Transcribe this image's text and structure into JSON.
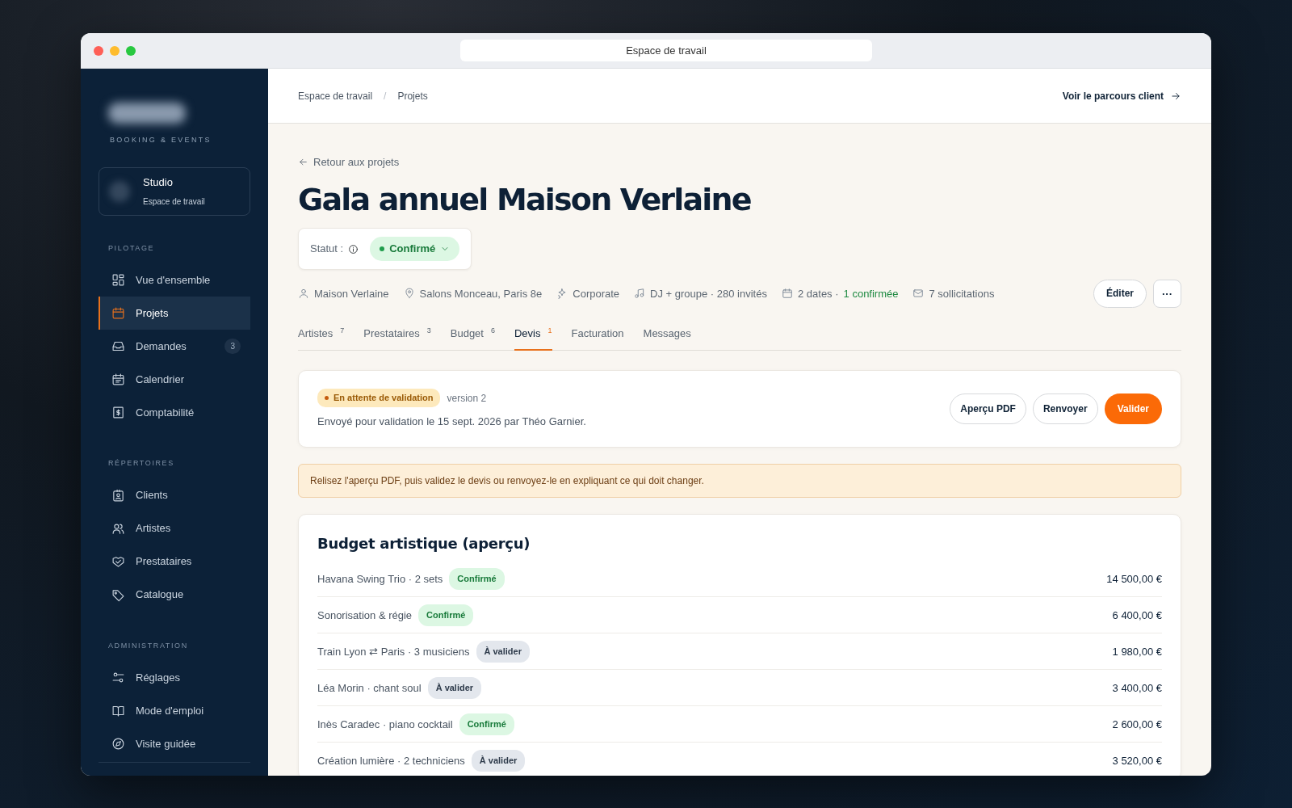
{
  "window": {
    "title": "Espace de travail"
  },
  "sidebar": {
    "tagline": "BOOKING & EVENTS",
    "workspace": {
      "name": "Studio",
      "subtitle": "Espace de travail"
    },
    "sections": [
      {
        "heading": "PILOTAGE",
        "items": [
          {
            "label": "Vue d'ensemble",
            "selected": false
          },
          {
            "label": "Projets",
            "selected": true
          },
          {
            "label": "Demandes",
            "selected": false,
            "count": "3"
          },
          {
            "label": "Calendrier",
            "selected": false
          },
          {
            "label": "Comptabilité",
            "selected": false
          }
        ]
      },
      {
        "heading": "RÉPERTOIRES",
        "items": [
          {
            "label": "Clients",
            "selected": false
          },
          {
            "label": "Artistes",
            "selected": false
          },
          {
            "label": "Prestataires",
            "selected": false
          },
          {
            "label": "Catalogue",
            "selected": false
          }
        ]
      },
      {
        "heading": "ADMINISTRATION",
        "items": [
          {
            "label": "Réglages",
            "selected": false
          },
          {
            "label": "Mode d'emploi",
            "selected": false
          },
          {
            "label": "Visite guidée",
            "selected": false
          }
        ]
      }
    ]
  },
  "breadcrumb": [
    "Espace de travail",
    "Projets"
  ],
  "breadcrumb_separator": "/",
  "client_link": "Voir le parcours client",
  "back_link": "Retour aux projets",
  "title": "Gala annuel Maison Verlaine",
  "status": {
    "label": "Statut :",
    "value": "Confirmé"
  },
  "meta": [
    {
      "text": "Maison Verlaine"
    },
    {
      "text": "Salons Monceau, Paris 8e"
    },
    {
      "text": "Corporate"
    },
    {
      "text": "DJ + groupe · 280 invités"
    },
    {
      "text": "2 dates ·",
      "highlight": "1 confirmée"
    },
    {
      "text": "7 sollicitations"
    }
  ],
  "actions": {
    "edit": "Éditer",
    "more": "···"
  },
  "tabs": [
    {
      "label": "Artistes",
      "count": "7",
      "selected": false
    },
    {
      "label": "Prestataires",
      "count": "3",
      "selected": false
    },
    {
      "label": "Budget",
      "count": "6",
      "selected": false
    },
    {
      "label": "Devis",
      "count": "1",
      "selected": true
    },
    {
      "label": "Facturation",
      "selected": false
    },
    {
      "label": "Messages",
      "selected": false
    }
  ],
  "quote": {
    "badge": "En attente de validation",
    "version": "version 2",
    "sent": "Envoyé pour validation le 15 sept. 2026 par Théo Garnier.",
    "buttons": [
      {
        "label": "Aperçu PDF",
        "kind": "outline"
      },
      {
        "label": "Renvoyer",
        "kind": "outline"
      },
      {
        "label": "Valider",
        "kind": "primary"
      }
    ]
  },
  "notice": "Relisez l'aperçu PDF, puis validez le devis ou renvoyez-le en expliquant ce qui doit changer.",
  "budget": {
    "title": "Budget artistique (aperçu)",
    "rows": [
      {
        "label": "Havana Swing Trio · 2 sets",
        "status": "Confirmé",
        "kind": "confirmed",
        "amount": "14 500,00 €"
      },
      {
        "label": "Sonorisation & régie",
        "status": "Confirmé",
        "kind": "confirmed",
        "amount": "6 400,00 €"
      },
      {
        "label": "Train Lyon ⇄ Paris · 3 musiciens",
        "status": "À valider",
        "kind": "pending",
        "amount": "1 980,00 €"
      },
      {
        "label": "Léa Morin · chant soul",
        "status": "À valider",
        "kind": "pending",
        "amount": "3 400,00 €"
      },
      {
        "label": "Inès Caradec · piano cocktail",
        "status": "Confirmé",
        "kind": "confirmed",
        "amount": "2 600,00 €"
      },
      {
        "label": "Création lumière · 2 techniciens",
        "status": "À valider",
        "kind": "pending",
        "amount": "3 520,00 €"
      }
    ]
  }
}
